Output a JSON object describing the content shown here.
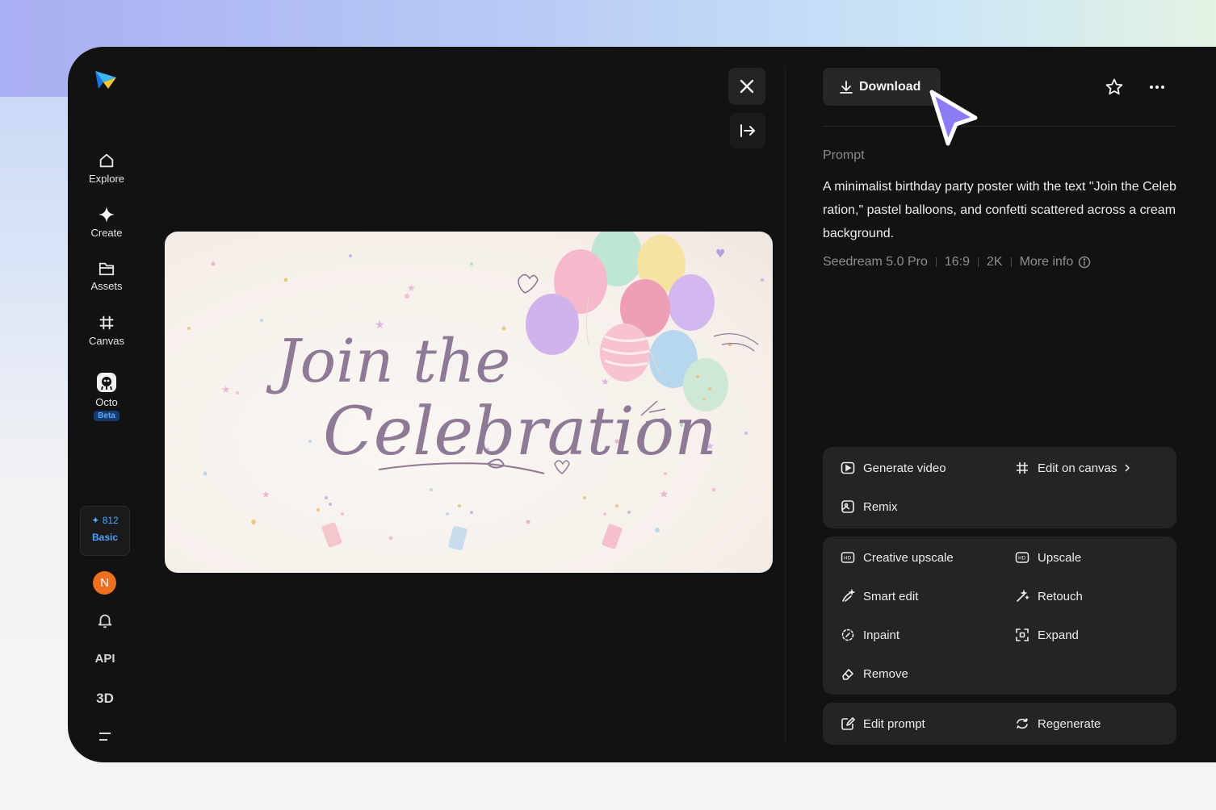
{
  "sidebar": {
    "items": [
      {
        "label": "Explore",
        "icon": "home-icon"
      },
      {
        "label": "Create",
        "icon": "sparkle-icon"
      },
      {
        "label": "Assets",
        "icon": "folder-icon"
      },
      {
        "label": "Canvas",
        "icon": "canvas-icon"
      },
      {
        "label": "Octo",
        "icon": "octo-icon",
        "badge": "Beta"
      }
    ],
    "credits": {
      "amount": "812",
      "plan": "Basic"
    },
    "avatar_initial": "N",
    "api_label": "API",
    "threed_label": "3D"
  },
  "image": {
    "title_line1": "Join the",
    "title_line2": "Celebration"
  },
  "panel": {
    "download_label": "Download",
    "prompt_label": "Prompt",
    "prompt_text": "A minimalist birthday party poster with the text \"Join the Celebration,\" pastel balloons, and confetti scattered across a cream background.",
    "meta": {
      "model": "Seedream 5.0 Pro",
      "ratio": "16:9",
      "resolution": "2K",
      "more_info": "More info"
    },
    "group1": {
      "generate_video": "Generate video",
      "edit_on_canvas": "Edit on canvas",
      "remix": "Remix"
    },
    "group2": {
      "creative_upscale": "Creative upscale",
      "upscale": "Upscale",
      "smart_edit": "Smart edit",
      "retouch": "Retouch",
      "inpaint": "Inpaint",
      "expand": "Expand",
      "remove": "Remove"
    },
    "group3": {
      "edit_prompt": "Edit prompt",
      "regenerate": "Regenerate"
    }
  },
  "colors": {
    "accent_blue": "#4ea3ff",
    "cursor_purple": "#8b7cf6",
    "avatar_orange": "#ee6f1e",
    "panel_bg": "#121212"
  }
}
